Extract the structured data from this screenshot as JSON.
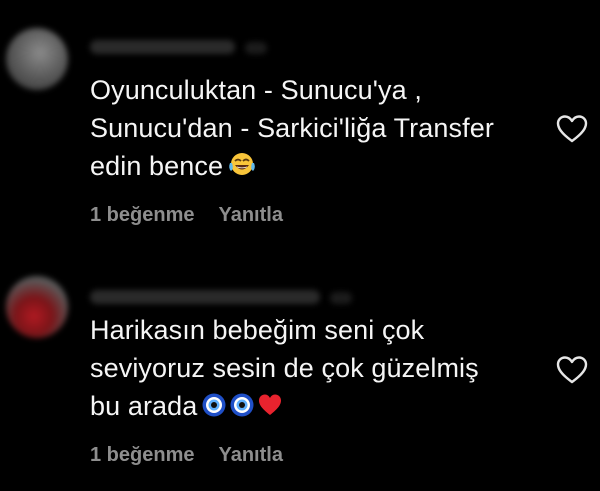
{
  "comments": [
    {
      "text_lines": [
        "Oyunculuktan - Sunucu'ya ,",
        "Sunucu'dan - Sarkici'liğa Transfer",
        "edin bence"
      ],
      "emoji": "laughing-tears-emoji",
      "likes_label": "1 beğenme",
      "reply_label": "Yanıtla",
      "like_icon": "heart-outline-icon"
    },
    {
      "text_lines": [
        "Harikasın bebeğim seni çok",
        "seviyoruz sesin de çok güzelmiş",
        "bu arada"
      ],
      "emoji": "evil-eye-evil-eye-red-heart-emoji",
      "likes_label": "1 beğenme",
      "reply_label": "Yanıtla",
      "like_icon": "heart-outline-icon"
    }
  ],
  "colors": {
    "background": "#000000",
    "text": "#f5f5f5",
    "secondary_text": "#8e8e8e",
    "heart_red": "#e0245e"
  }
}
